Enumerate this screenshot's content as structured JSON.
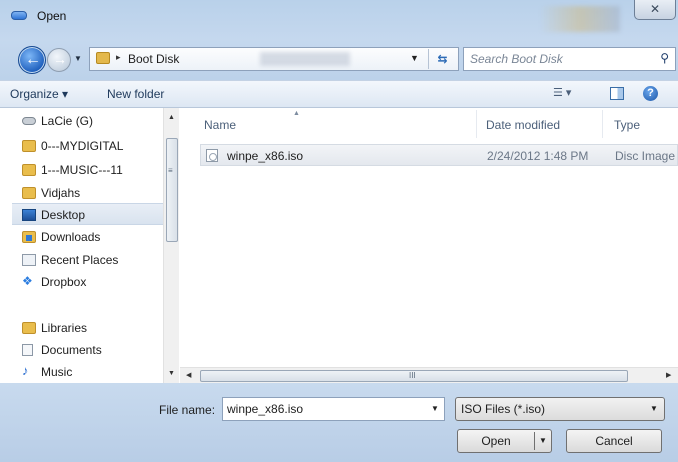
{
  "window": {
    "title": "Open",
    "close_label": "✕"
  },
  "address_bar": {
    "breadcrumb": "Boot Disk",
    "separator": "▸"
  },
  "search": {
    "placeholder": "Search Boot Disk"
  },
  "toolbar": {
    "organize": "Organize ▾",
    "new_folder": "New folder"
  },
  "sidebar": {
    "items": [
      {
        "label": "LaCie (G)",
        "icon": "drive-icon"
      },
      {
        "label": "0---MYDIGITAL",
        "icon": "folder-icon"
      },
      {
        "label": "1---MUSIC---11",
        "icon": "folder-icon"
      },
      {
        "label": "Vidjahs",
        "icon": "folder-icon"
      },
      {
        "label": "Desktop",
        "icon": "desktop-icon",
        "selected": true
      },
      {
        "label": "Downloads",
        "icon": "downloads-icon"
      },
      {
        "label": "Recent Places",
        "icon": "recent-places-icon"
      },
      {
        "label": "Dropbox",
        "icon": "dropbox-icon"
      },
      {
        "label": "Libraries",
        "icon": "libraries-icon"
      },
      {
        "label": "Documents",
        "icon": "documents-icon"
      },
      {
        "label": "Music",
        "icon": "music-icon"
      }
    ]
  },
  "file_list": {
    "columns": [
      "Name",
      "Date modified",
      "Type"
    ],
    "rows": [
      {
        "name": "winpe_x86.iso",
        "date_modified": "2/24/2012 1:48 PM",
        "type": "Disc Image"
      }
    ]
  },
  "footer": {
    "file_name_label": "File name:",
    "file_name_value": "winpe_x86.iso",
    "file_type": "ISO Files (*.iso)",
    "open_label": "Open",
    "cancel_label": "Cancel"
  }
}
